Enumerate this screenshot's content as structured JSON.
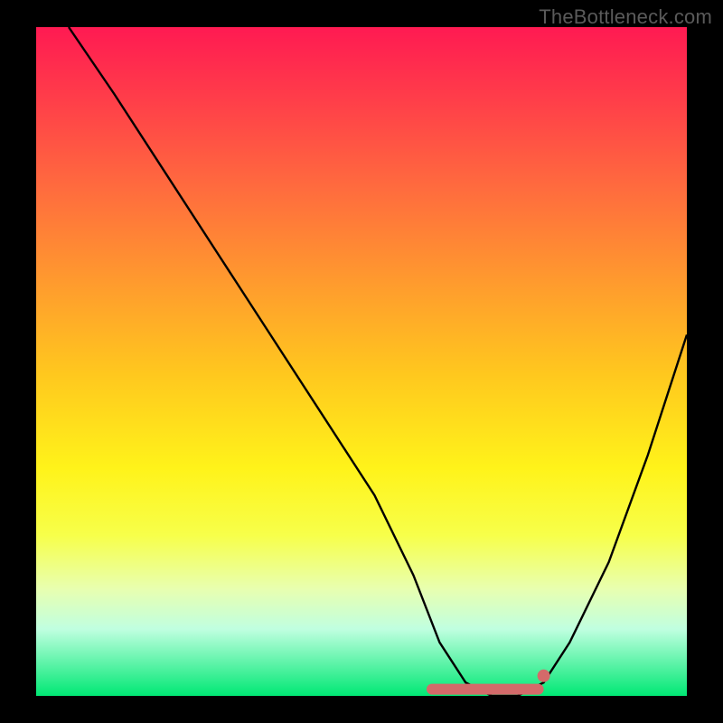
{
  "watermark": "TheBottleneck.com",
  "chart_data": {
    "type": "line",
    "title": "",
    "xlabel": "",
    "ylabel": "",
    "xlim": [
      0,
      100
    ],
    "ylim": [
      0,
      100
    ],
    "series": [
      {
        "name": "bottleneck-curve",
        "x": [
          5,
          12,
          20,
          28,
          36,
          44,
          52,
          58,
          62,
          66,
          70,
          74,
          78,
          82,
          88,
          94,
          100
        ],
        "values": [
          100,
          90,
          78,
          66,
          54,
          42,
          30,
          18,
          8,
          2,
          0,
          0,
          2,
          8,
          20,
          36,
          54
        ]
      }
    ],
    "marker_band": {
      "x_start": 60,
      "x_end": 78,
      "y": 1
    },
    "marker_dot": {
      "x": 78,
      "y": 3
    },
    "colors": {
      "curve": "#000000",
      "marker": "#d46a6a",
      "gradient_top": "#ff1a52",
      "gradient_bottom": "#00e874"
    }
  }
}
